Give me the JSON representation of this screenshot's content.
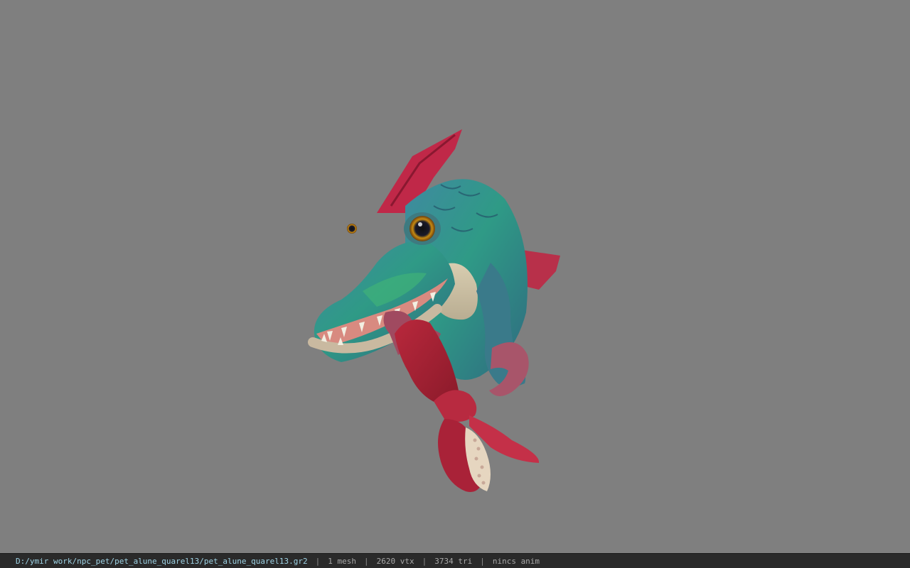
{
  "viewport": {
    "background_color": "#7f7f7f",
    "model_icon": "fish-creature-3d-model"
  },
  "status_bar": {
    "file_path": "D:/ymir work/npc_pet/pet_alune_quarel13/pet_alune_quarel13.gr2",
    "separator": "|",
    "mesh_count": "1 mesh",
    "vertex_count": "2620 vtx",
    "triangle_count": "3734 tri",
    "animation_status": "nincs anim",
    "path_color": "#9fd4e6",
    "text_color": "#a8a8a8"
  }
}
